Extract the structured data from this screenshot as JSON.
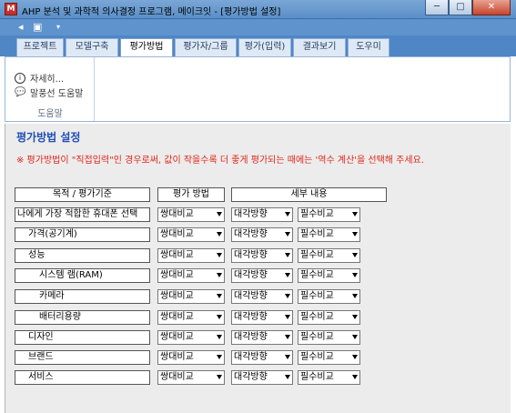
{
  "window": {
    "title": "AHP 분석 및 과학적 의사결정 프로그램, 메이크잇 - [평가방법 설정]",
    "min": "─",
    "max": "□",
    "close": "✕"
  },
  "tabs": [
    {
      "label": "프로젝트"
    },
    {
      "label": "모델구축"
    },
    {
      "label": "평가방법"
    },
    {
      "label": "평가자/그룹"
    },
    {
      "label": "평가(입력)"
    },
    {
      "label": "결과보기"
    },
    {
      "label": "도우미"
    }
  ],
  "ribbon": {
    "item1": "자세히...",
    "item2": "말풍선 도움말",
    "group_label": "도움말"
  },
  "panel": {
    "title": "평가방법 설정",
    "notice": "※ 평가방법이 \"직접입력\"인 경우로써, 값이 작을수록 더 좋게 평가되는 때에는 '역수 계산'을 선택해 주세요.",
    "headers": {
      "criteria": "목적 / 평가기준",
      "method": "평가 방법",
      "detail": "세부 내용"
    }
  },
  "rows": [
    {
      "name": "나에게 가장 적합한 휴대폰 선택",
      "method": "쌍대비교",
      "direction": "대각방향",
      "required": "필수비교"
    },
    {
      "name": "가격(공기계)",
      "method": "쌍대비교",
      "direction": "대각방향",
      "required": "필수비교"
    },
    {
      "name": "성능",
      "method": "쌍대비교",
      "direction": "대각방향",
      "required": "필수비교"
    },
    {
      "name": "시스템 램(RAM)",
      "method": "쌍대비교",
      "direction": "대각방향",
      "required": "필수비교"
    },
    {
      "name": "카메라",
      "method": "쌍대비교",
      "direction": "대각방향",
      "required": "필수비교"
    },
    {
      "name": "배터리용량",
      "method": "쌍대비교",
      "direction": "대각방향",
      "required": "필수비교"
    },
    {
      "name": "디자인",
      "method": "쌍대비교",
      "direction": "대각방향",
      "required": "필수비교"
    },
    {
      "name": "브랜드",
      "method": "쌍대비교",
      "direction": "대각방향",
      "required": "필수비교"
    },
    {
      "name": "서비스",
      "method": "쌍대비교",
      "direction": "대각방향",
      "required": "필수비교"
    }
  ]
}
